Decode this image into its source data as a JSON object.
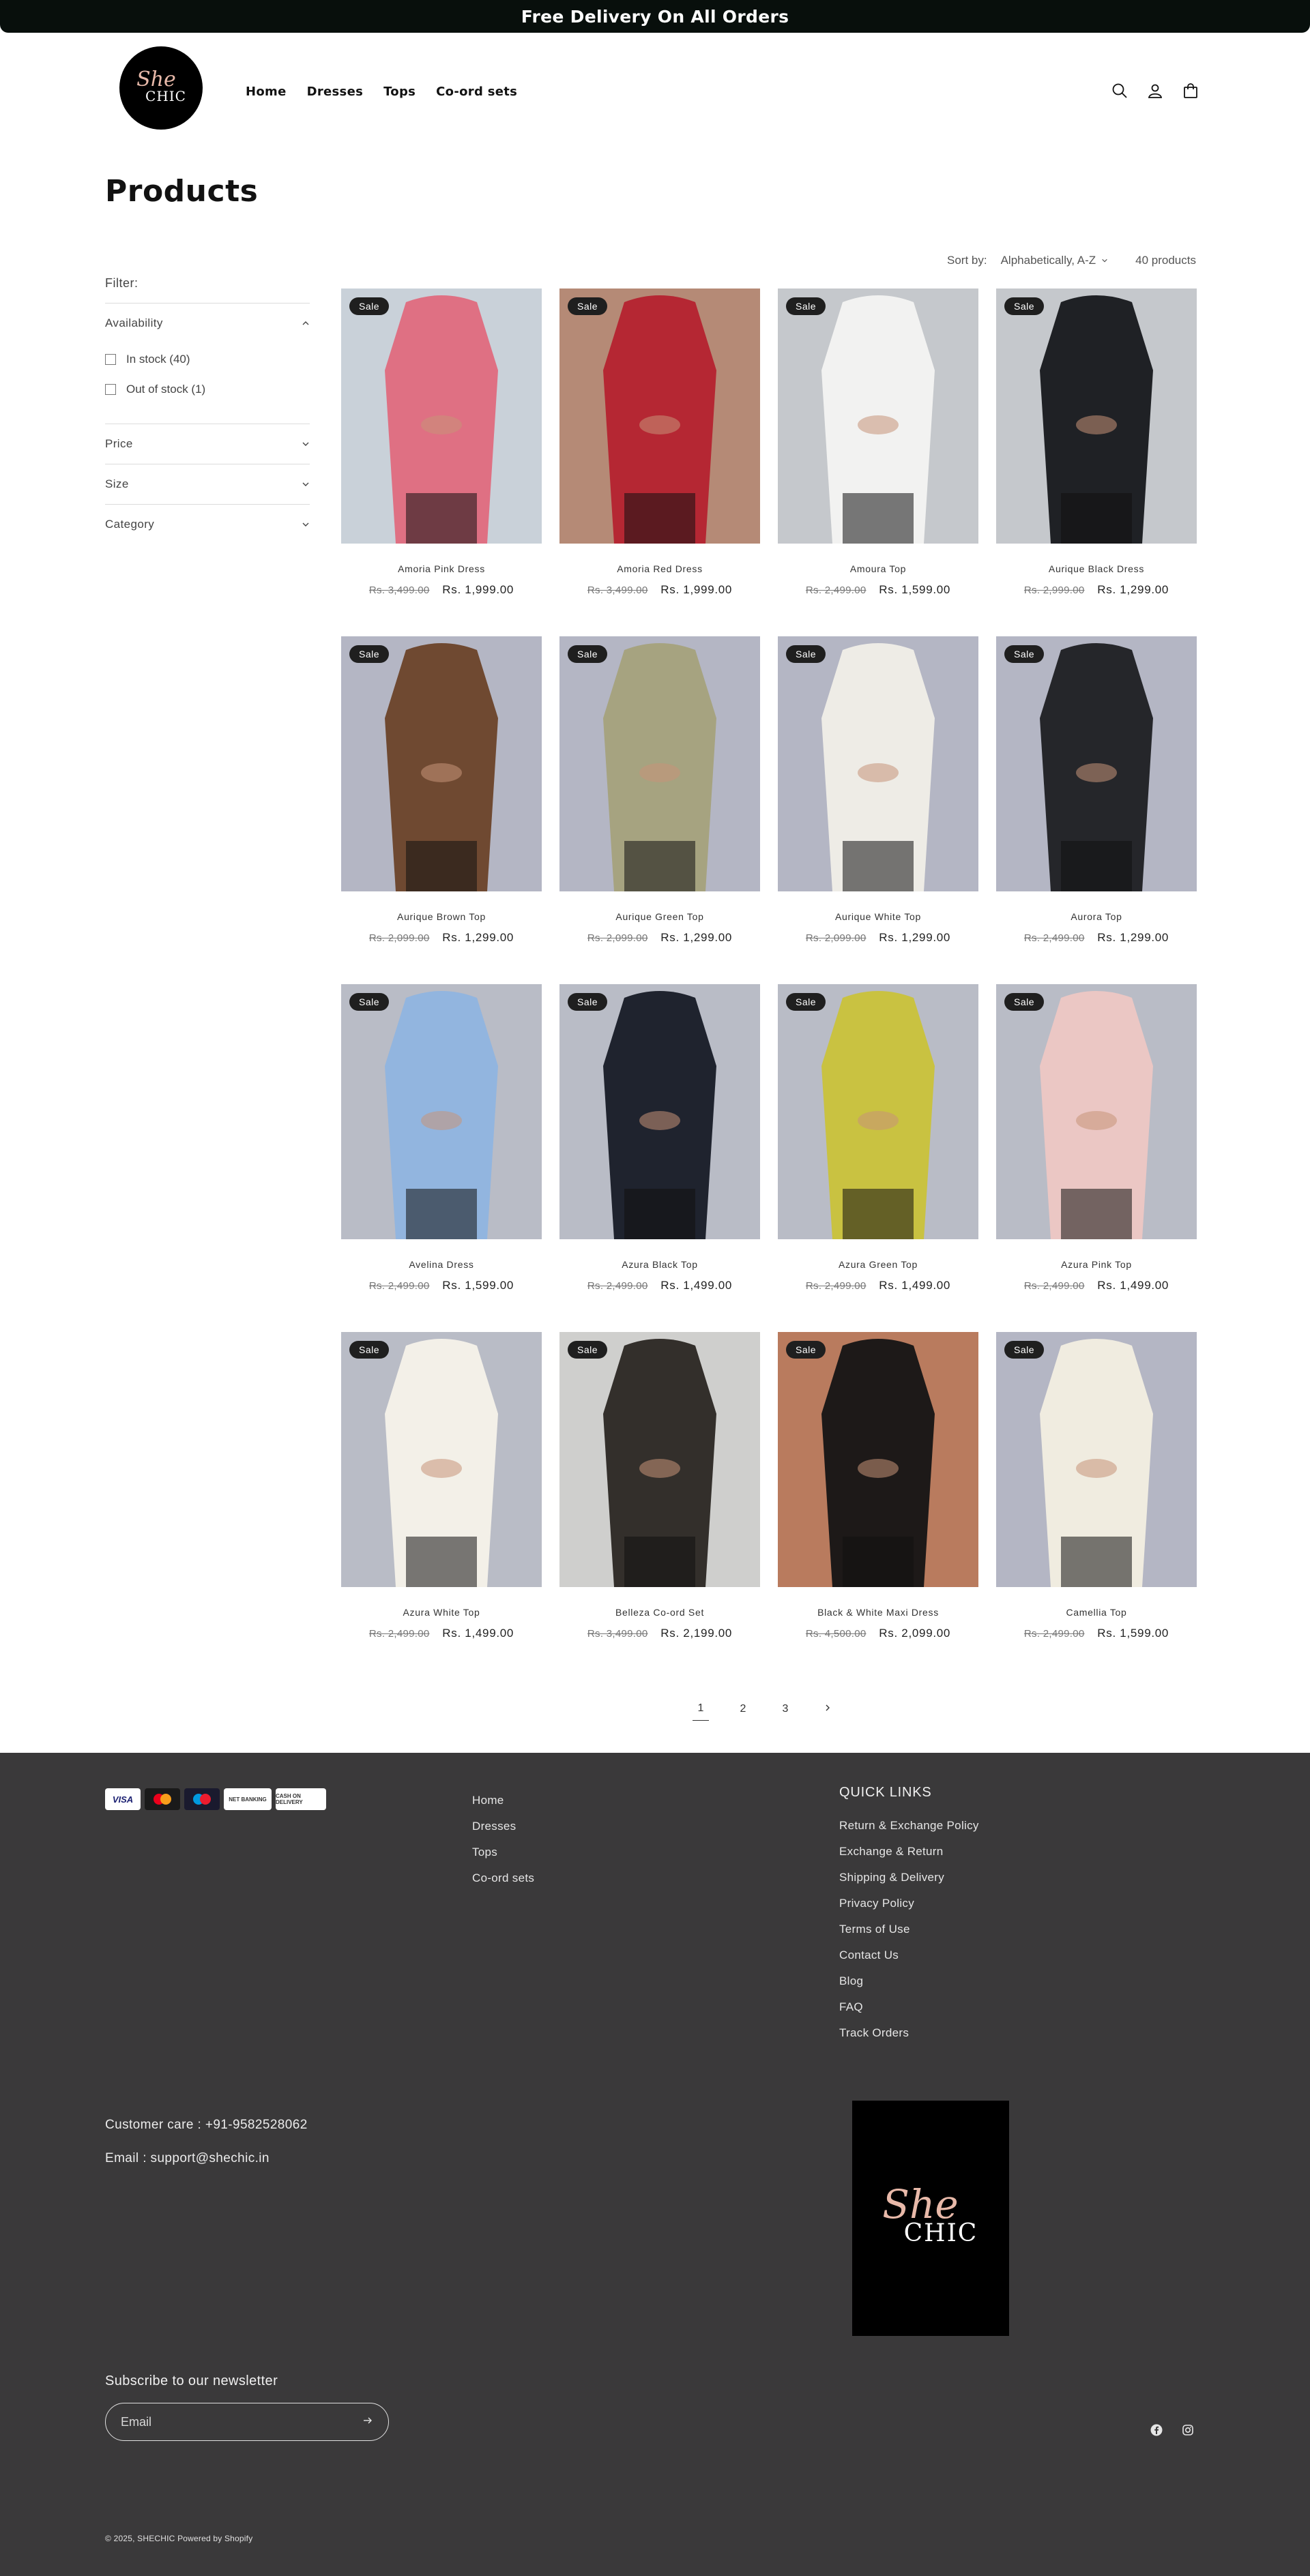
{
  "announcement": "Free Delivery On All Orders",
  "header": {
    "logo": {
      "line1": "She",
      "line2": "CHIC"
    },
    "nav": [
      "Home",
      "Dresses",
      "Tops",
      "Co-ord sets"
    ],
    "icons": [
      "search-icon",
      "account-icon",
      "cart-icon"
    ]
  },
  "page_title": "Products",
  "filters": {
    "label": "Filter:",
    "availability": {
      "title": "Availability",
      "options": [
        "In stock (40)",
        "Out of stock (1)"
      ]
    },
    "price": "Price",
    "size": "Size",
    "category": "Category"
  },
  "sort": {
    "label": "Sort by:",
    "value": "Alphabetically, A-Z",
    "count": "40 products"
  },
  "products": [
    {
      "name": "Amoria Pink Dress",
      "old": "Rs. 3,499.00",
      "price": "Rs. 1,999.00",
      "badge": "Sale",
      "colors": [
        "#c9d1d9",
        "#e06a7e"
      ]
    },
    {
      "name": "Amoria Red Dress",
      "old": "Rs. 3,499.00",
      "price": "Rs. 1,999.00",
      "badge": "Sale",
      "colors": [
        "#b58a76",
        "#b5222f"
      ]
    },
    {
      "name": "Amoura Top",
      "old": "Rs. 2,499.00",
      "price": "Rs. 1,599.00",
      "badge": "Sale",
      "colors": [
        "#c5c8cc",
        "#f4f4f2"
      ]
    },
    {
      "name": "Aurique Black Dress",
      "old": "Rs. 2,999.00",
      "price": "Rs. 1,299.00",
      "badge": "Sale",
      "colors": [
        "#c5c8cc",
        "#16181b"
      ]
    },
    {
      "name": "Aurique Brown Top",
      "old": "Rs. 2,099.00",
      "price": "Rs. 1,299.00",
      "badge": "Sale",
      "colors": [
        "#b4b6c4",
        "#6b4329"
      ]
    },
    {
      "name": "Aurique Green Top",
      "old": "Rs. 2,099.00",
      "price": "Rs. 1,299.00",
      "badge": "Sale",
      "colors": [
        "#b4b6c4",
        "#a5a27c"
      ]
    },
    {
      "name": "Aurique White Top",
      "old": "Rs. 2,099.00",
      "price": "Rs. 1,299.00",
      "badge": "Sale",
      "colors": [
        "#b4b6c4",
        "#f1efe8"
      ]
    },
    {
      "name": "Aurora Top",
      "old": "Rs. 2,499.00",
      "price": "Rs. 1,299.00",
      "badge": "Sale",
      "colors": [
        "#b4b6c4",
        "#1e1f22"
      ]
    },
    {
      "name": "Avelina Dress",
      "old": "Rs. 2,499.00",
      "price": "Rs. 1,599.00",
      "badge": "Sale",
      "colors": [
        "#b9bcc6",
        "#8fb4e0"
      ]
    },
    {
      "name": "Azura Black Top",
      "old": "Rs. 2,499.00",
      "price": "Rs. 1,499.00",
      "badge": "Sale",
      "colors": [
        "#b9bcc6",
        "#161a26"
      ]
    },
    {
      "name": "Azura Green Top",
      "old": "Rs. 2,499.00",
      "price": "Rs. 1,499.00",
      "badge": "Sale",
      "colors": [
        "#b9bcc6",
        "#c9c23a"
      ]
    },
    {
      "name": "Azura Pink Top",
      "old": "Rs. 2,499.00",
      "price": "Rs. 1,499.00",
      "badge": "Sale",
      "colors": [
        "#b9bcc6",
        "#edc7c4"
      ]
    },
    {
      "name": "Azura White Top",
      "old": "Rs. 2,499.00",
      "price": "Rs. 1,499.00",
      "badge": "Sale",
      "colors": [
        "#b9bcc6",
        "#f5f2ea"
      ]
    },
    {
      "name": "Belleza Co-ord Set",
      "old": "Rs. 3,499.00",
      "price": "Rs. 2,199.00",
      "badge": "Sale",
      "colors": [
        "#cfcfcd",
        "#2a2622"
      ]
    },
    {
      "name": "Black & White Maxi Dress",
      "old": "Rs. 4,500.00",
      "price": "Rs. 2,099.00",
      "badge": "Sale",
      "colors": [
        "#b97b5e",
        "#141414"
      ]
    },
    {
      "name": "Camellia Top",
      "old": "Rs. 2,499.00",
      "price": "Rs. 1,599.00",
      "badge": "Sale",
      "colors": [
        "#b4b6c4",
        "#f3efe2"
      ]
    }
  ],
  "pagination": {
    "pages": [
      "1",
      "2",
      "3"
    ],
    "current": "1",
    "next": "chevron-right-icon"
  },
  "footer": {
    "payments": [
      "VISA",
      "MC",
      "MAESTRO",
      "NET BANKING",
      "CASH ON DELIVERY"
    ],
    "menu": [
      "Home",
      "Dresses",
      "Tops",
      "Co-ord sets"
    ],
    "quick_title": "QUICK LINKS",
    "quick_links": [
      "Return & Exchange Policy",
      "Exchange & Return",
      "Shipping & Delivery",
      "Privacy Policy",
      "Terms of Use",
      "Contact Us",
      "Blog",
      "FAQ",
      "Track Orders"
    ],
    "customer_care": "Customer care : +91-9582528062",
    "email": "Email : support@shechic.in",
    "logo": {
      "line1": "She",
      "line2": "CHIC"
    },
    "newsletter_title": "Subscribe to our newsletter",
    "email_placeholder": "Email",
    "socials": [
      "facebook-icon",
      "instagram-icon"
    ],
    "copyright": "© 2025, SHECHIC Powered by Shopify"
  }
}
